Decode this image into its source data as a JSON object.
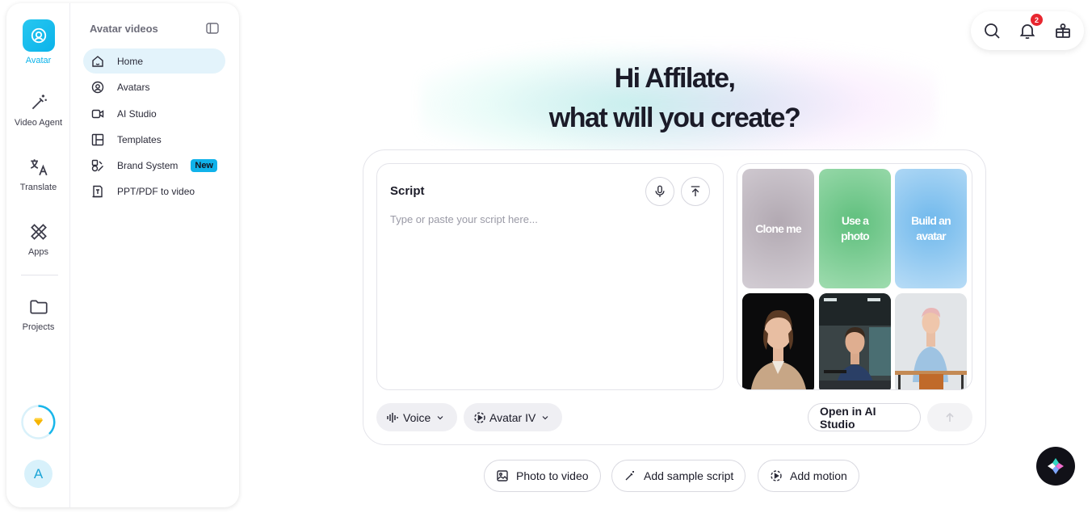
{
  "rail": {
    "items": [
      {
        "label": "Avatar",
        "icon": "avatar-icon",
        "active": true
      },
      {
        "label": "Video Agent",
        "icon": "magic-wand-icon"
      },
      {
        "label": "Translate",
        "icon": "translate-icon"
      },
      {
        "label": "Apps",
        "icon": "apps-icon"
      },
      {
        "label": "Projects",
        "icon": "folder-icon"
      }
    ],
    "user_initial": "A",
    "credits_icon": "diamond-icon"
  },
  "subnav": {
    "title": "Avatar videos",
    "items": [
      {
        "label": "Home",
        "icon": "home-icon",
        "active": true
      },
      {
        "label": "Avatars",
        "icon": "avatar-circle-icon"
      },
      {
        "label": "AI Studio",
        "icon": "video-camera-icon"
      },
      {
        "label": "Templates",
        "icon": "templates-icon"
      },
      {
        "label": "Brand System",
        "icon": "brand-kit-icon",
        "badge": "New"
      },
      {
        "label": "PPT/PDF to video",
        "icon": "document-icon"
      }
    ]
  },
  "toolbar": {
    "notification_count": "2"
  },
  "hero": {
    "line1": "Hi Affilate,",
    "line2": "what will you create?"
  },
  "script": {
    "title": "Script",
    "placeholder": "Type or paste your script here..."
  },
  "avatar_tiles": [
    {
      "label": "Clone me",
      "color": "#c9c1c9"
    },
    {
      "label": "Use a photo",
      "color": "#7fd09a"
    },
    {
      "label": "Build an avatar",
      "color": "#8fc8f0"
    }
  ],
  "controls": {
    "voice": "Voice",
    "avatar_model": "Avatar IV",
    "open_studio": "Open in AI Studio"
  },
  "suggestions": [
    {
      "label": "Photo to video",
      "icon": "image-icon"
    },
    {
      "label": "Add sample script",
      "icon": "wand-icon"
    },
    {
      "label": "Add motion",
      "icon": "motion-icon"
    }
  ],
  "colors": {
    "accent": "#0ab3ea",
    "active_nav_bg": "#e3f3fb",
    "notification": "#e8262f"
  }
}
